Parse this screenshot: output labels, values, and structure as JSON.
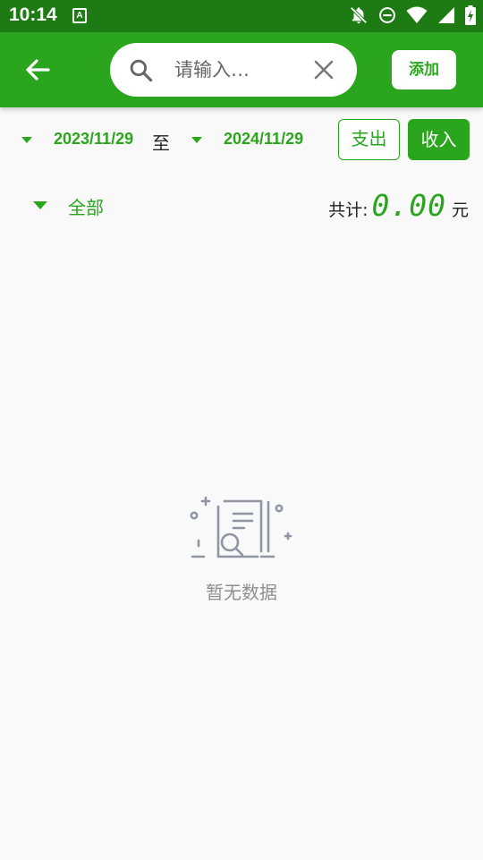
{
  "status_bar": {
    "time": "10:14",
    "app_badge": "A",
    "icons": [
      "notifications-off-icon",
      "do-not-disturb-icon",
      "wifi-icon",
      "cell-signal-icon",
      "battery-charging-icon"
    ]
  },
  "app_bar": {
    "back_icon": "arrow-left-icon",
    "search": {
      "placeholder": "请输入…",
      "value": ""
    },
    "add_label": "添加",
    "color": "#2ba51d"
  },
  "date_range": {
    "start": "2023/11/29",
    "separator": "至",
    "end": "2024/11/29",
    "expense_label": "支出",
    "income_label": "收入"
  },
  "filter": {
    "category": "全部",
    "total_label": "共计:",
    "total_value": "0.00",
    "currency": "元"
  },
  "empty_state": {
    "icon": "document-search-icon",
    "message": "暂无数据"
  }
}
